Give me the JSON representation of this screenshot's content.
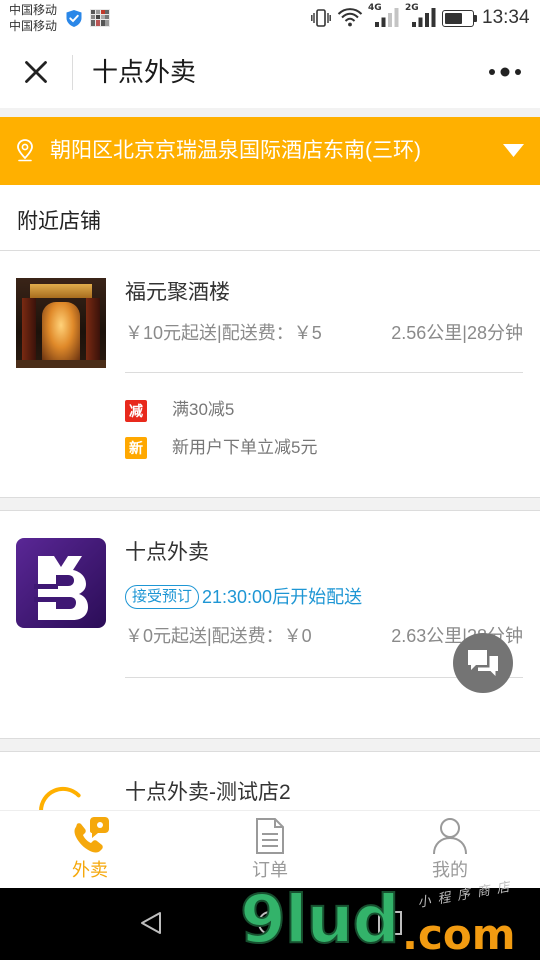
{
  "status_bar": {
    "carriers": [
      "中国移动",
      "中国移动"
    ],
    "sim1_network": "4G",
    "sim1_signal_level": 2,
    "sim2_network": "2G",
    "sim2_signal_level": 4,
    "signal_max": 4,
    "battery_level": 0.65,
    "time": "13:34",
    "icons": [
      "security-shield-icon",
      "notification-app-icon",
      "vibrate-icon",
      "wifi-icon",
      "signal-icon",
      "battery-icon"
    ]
  },
  "header": {
    "title": "十点外卖",
    "icons": [
      "close-icon",
      "more-dots-icon"
    ]
  },
  "address_bar": {
    "address": "朝阳区北京京瑞温泉国际酒店东南(三环)",
    "icons": [
      "location-pin-icon",
      "dropdown-triangle-icon"
    ]
  },
  "section": {
    "title": "附近店铺"
  },
  "stores": [
    {
      "name": "福元聚酒楼",
      "delivery_info": "￥10元起送|配送费：￥5",
      "distance_time": "2.56公里|28分钟",
      "promotions": [
        {
          "badge": "减",
          "text": "满30减5",
          "color": "#E8291C"
        },
        {
          "badge": "新",
          "text": "新用户下单立减5元",
          "color": "#FFA800"
        }
      ]
    },
    {
      "name": "十点外卖",
      "tag": "接受预订",
      "schedule": "21:30:00后开始配送",
      "delivery_info": "￥0元起送|配送费：￥0",
      "distance_time": "2.63公里|28分钟"
    },
    {
      "name": "十点外卖-测试店2",
      "icons": [
        "loading-spinner-icon"
      ]
    }
  ],
  "floating_button": {
    "icon": "chat-bubbles-icon"
  },
  "tabs": [
    {
      "label": "外卖",
      "icon": "takeout-phone-icon",
      "active": true
    },
    {
      "label": "订单",
      "icon": "order-document-icon",
      "active": false
    },
    {
      "label": "我的",
      "icon": "profile-person-icon",
      "active": false
    }
  ],
  "system_nav": {
    "icons": [
      "back-icon",
      "home-icon",
      "recent-apps-icon"
    ]
  },
  "watermark": {
    "brand": "9lud",
    "domain": ".com",
    "slogan": "小程序商店"
  },
  "colors": {
    "accent": "#FFB000",
    "tab_active": "#F5A80C",
    "tab_inactive": "#9A9A9A",
    "link_blue": "#1E96D4",
    "text_primary": "#333333",
    "text_secondary": "#8A8A8A",
    "float_button": "#747474",
    "watermark_green": "#33B36A",
    "watermark_orange": "#F29B11"
  }
}
